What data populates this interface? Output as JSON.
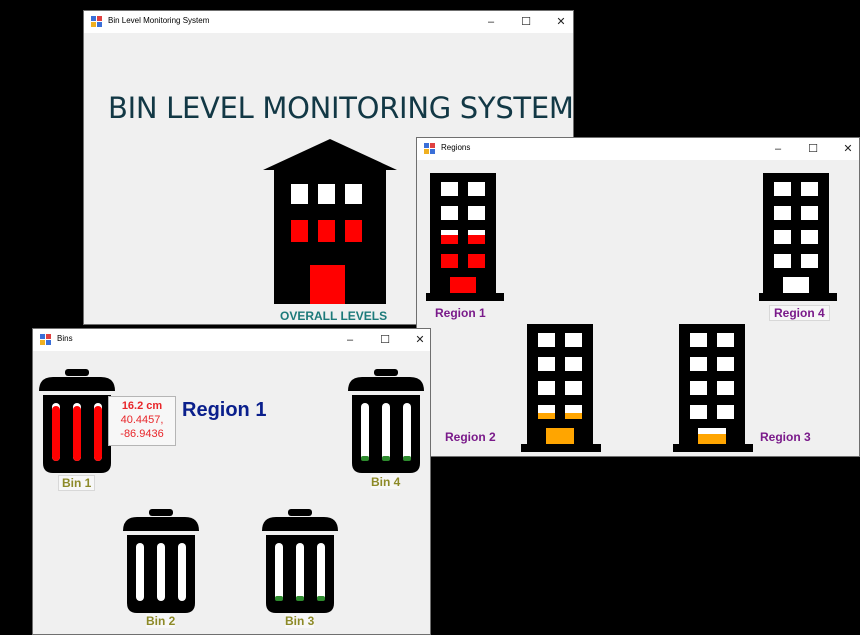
{
  "main_window": {
    "title": "Bin Level Monitoring System",
    "heading": "BIN LEVEL MONITORING SYSTEM",
    "overall_label": "OVERALL LEVELS",
    "fill_level": 0.5,
    "fill_color": "#ff0000"
  },
  "regions_window": {
    "title": "Regions",
    "regions": [
      {
        "label": "Region 1",
        "fill_color": "#ff0000",
        "fill_level": 0.45
      },
      {
        "label": "Region 4",
        "fill_color": "#ffffff",
        "fill_level": 0
      },
      {
        "label": "Region 2",
        "fill_color": "#ffa500",
        "fill_level": 0.3
      },
      {
        "label": "Region 3",
        "fill_color": "#ffa500",
        "fill_level": 0.15
      }
    ]
  },
  "bins_window": {
    "title": "Bins",
    "region_title": "Region 1",
    "info": {
      "distance": "16.2 cm",
      "lat": "40.4457,",
      "lon": "-86.9436"
    },
    "bins": [
      {
        "label": "Bin 1",
        "fill_level": 0.95,
        "fill_color": "#ff0000"
      },
      {
        "label": "Bin 4",
        "fill_level": 0.05,
        "fill_color": "#2e8b2e"
      },
      {
        "label": "Bin 2",
        "fill_level": 0,
        "fill_color": "#ffffff"
      },
      {
        "label": "Bin 3",
        "fill_level": 0.05,
        "fill_color": "#2e8b2e"
      }
    ]
  },
  "window_controls": {
    "minimize": "–",
    "maximize": "☐",
    "close": "✕"
  },
  "colors": {
    "heading": "#123845",
    "overall_label": "#1c7a7a",
    "region_label": "#7a1a8a",
    "region_title": "#0a1f8c",
    "bin_label": "#8d8a28",
    "info_text": "#e8262a"
  }
}
